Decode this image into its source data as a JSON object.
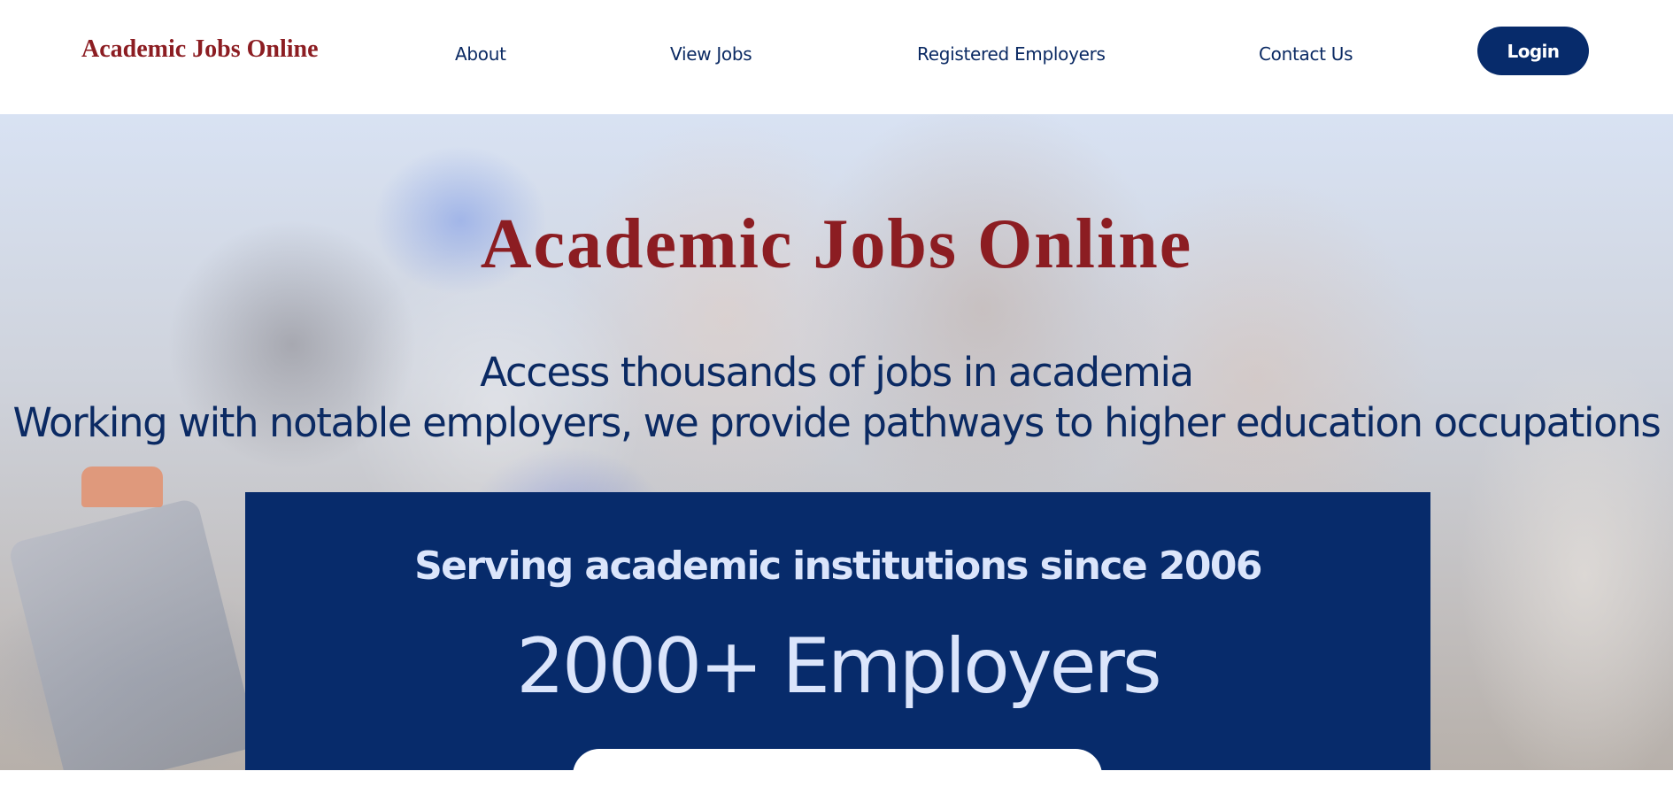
{
  "header": {
    "logo": "Academic Jobs Online",
    "nav": {
      "about": "About",
      "view_jobs": "View Jobs",
      "registered_employers": "Registered Employers",
      "contact_us": "Contact Us"
    },
    "login_label": "Login"
  },
  "hero": {
    "title": "Academic Jobs Online",
    "subtitle_line1": "Access thousands of jobs in academia",
    "subtitle_line2": "Working with notable employers, we provide pathways to higher education occupations"
  },
  "stats": {
    "tagline": "Serving academic institutions since 2006",
    "employer_count": "2000+ Employers"
  },
  "colors": {
    "brand_red": "#8c1d22",
    "brand_navy": "#072b6b",
    "panel_text": "#dbe5fb"
  }
}
